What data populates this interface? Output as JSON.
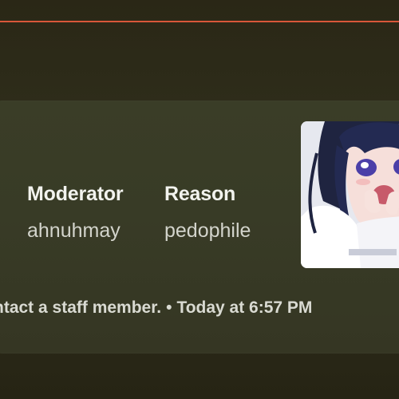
{
  "embed": {
    "fields": [
      {
        "name": "Moderator",
        "value": "ahnuhmay"
      },
      {
        "name": "Reason",
        "value": "pedophile"
      }
    ],
    "thumbnail_icon": "anime-character-thumbnail",
    "footer": {
      "text": "ntact a staff member.",
      "separator": "•",
      "timestamp": "Today at 6:57 PM"
    }
  },
  "colors": {
    "accent": "#d8563a",
    "background": "#2d2b1a",
    "embed_background": "#383b26"
  }
}
